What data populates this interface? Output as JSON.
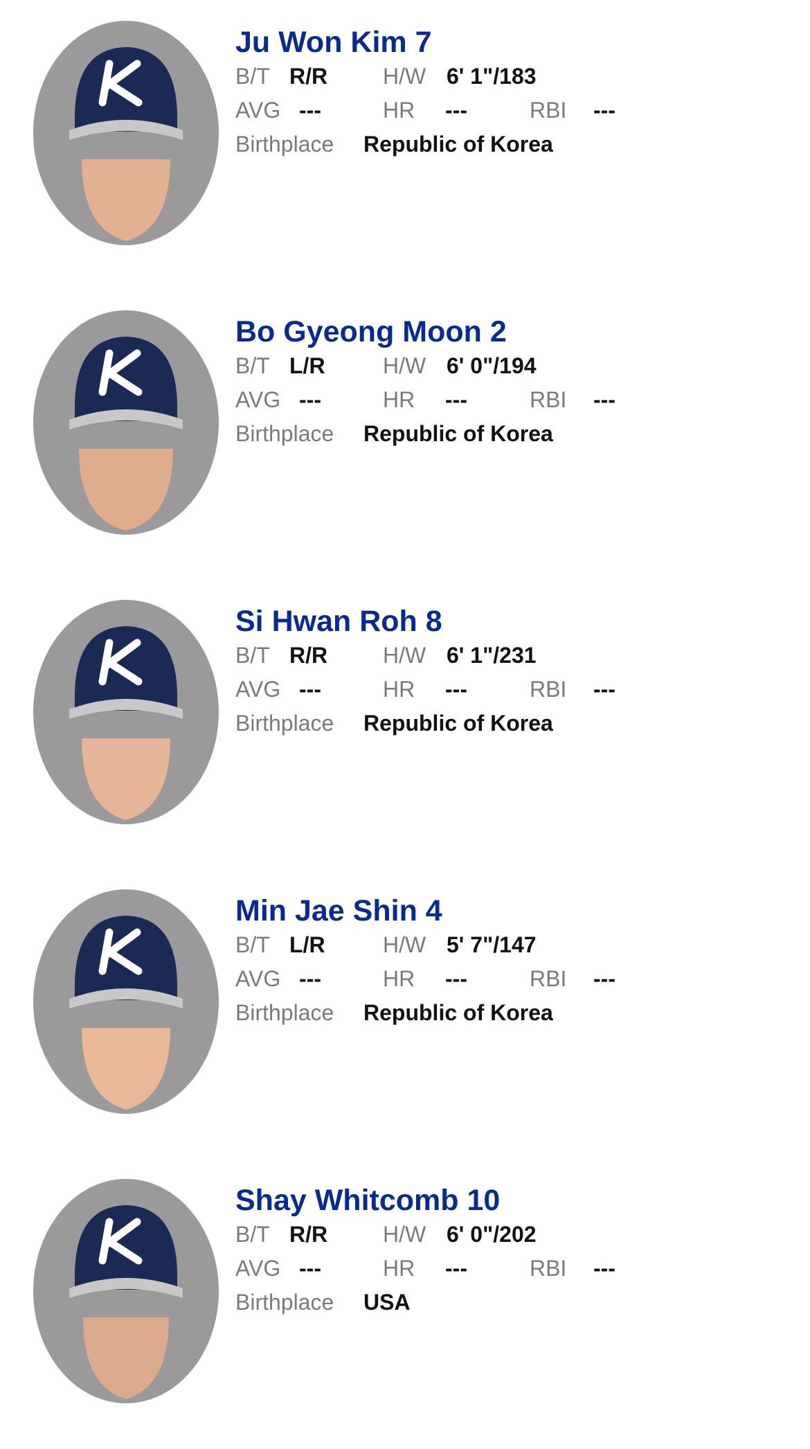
{
  "labels": {
    "bt": "B/T",
    "hw": "H/W",
    "avg": "AVG",
    "hr": "HR",
    "rbi": "RBI",
    "birthplace": "Birthplace"
  },
  "colors": {
    "name": "#0a2a8e",
    "cap": "#1b2a55",
    "cap_logo": "#ffffff",
    "portrait_bg": "#9a9a9a"
  },
  "players": [
    {
      "name": "Ju Won Kim 7",
      "bt": "R/R",
      "hw": "6' 1\"/183",
      "avg": "---",
      "hr": "---",
      "rbi": "---",
      "birthplace": "Republic of Korea",
      "cap_logo_icon": "k-logo-icon"
    },
    {
      "name": "Bo Gyeong Moon 2",
      "bt": "L/R",
      "hw": "6' 0\"/194",
      "avg": "---",
      "hr": "---",
      "rbi": "---",
      "birthplace": "Republic of Korea",
      "cap_logo_icon": "k-logo-icon"
    },
    {
      "name": "Si Hwan Roh 8",
      "bt": "R/R",
      "hw": "6' 1\"/231",
      "avg": "---",
      "hr": "---",
      "rbi": "---",
      "birthplace": "Republic of Korea",
      "cap_logo_icon": "k-logo-icon"
    },
    {
      "name": "Min Jae Shin 4",
      "bt": "L/R",
      "hw": "5' 7\"/147",
      "avg": "---",
      "hr": "---",
      "rbi": "---",
      "birthplace": "Republic of Korea",
      "cap_logo_icon": "k-logo-icon"
    },
    {
      "name": "Shay Whitcomb 10",
      "bt": "R/R",
      "hw": "6' 0\"/202",
      "avg": "---",
      "hr": "---",
      "rbi": "---",
      "birthplace": "USA",
      "cap_logo_icon": "k-logo-icon"
    }
  ]
}
